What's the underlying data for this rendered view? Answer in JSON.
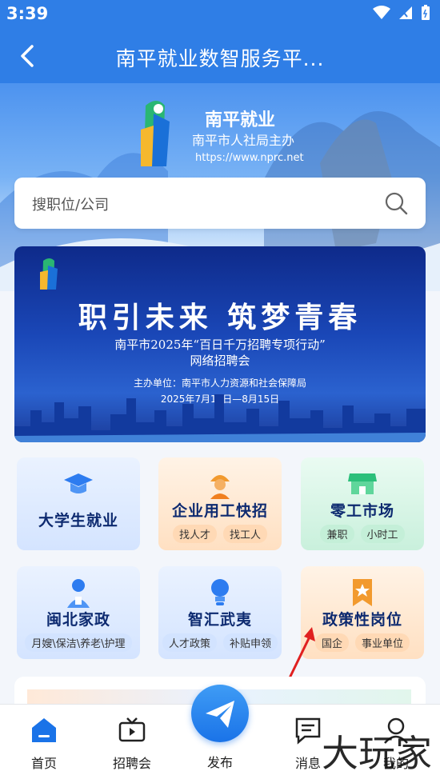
{
  "status_bar": {
    "time": "3:39"
  },
  "header": {
    "title": "南平就业数智服务平..."
  },
  "brand": {
    "name": "南平就业",
    "subtitle": "南平市人社局主办",
    "url": "https://www.nprc.net"
  },
  "search": {
    "placeholder": "搜职位/公司"
  },
  "banner": {
    "slogan": "职引未来  筑梦青春",
    "line1": "南平市2025年“百日千万招聘专项行动”",
    "line2": "网络招聘会",
    "organizer": "主办单位：南平市人力资源和社会保障局",
    "dates": "2025年7月15日—8月15日"
  },
  "services": [
    {
      "title": "大学生就业",
      "tags": []
    },
    {
      "title": "企业用工快招",
      "tags": [
        "找人才",
        "找工人"
      ]
    },
    {
      "title": "零工市场",
      "tags": [
        "兼职",
        "小时工"
      ]
    },
    {
      "title": "闽北家政",
      "tags": [
        "月嫂\\保洁\\养老\\护理"
      ]
    },
    {
      "title": "智汇武夷",
      "tags": [
        "人才政策",
        "补贴申领"
      ]
    },
    {
      "title": "政策性岗位",
      "tags": [
        "国企",
        "事业单位"
      ]
    }
  ],
  "nav": {
    "home": "首页",
    "job_fair": "招聘会",
    "publish": "发布",
    "messages": "消息",
    "mine": "我的"
  },
  "watermark": "大玩家",
  "colors": {
    "primary": "#2f7ee6",
    "nav_active": "#1a73e8"
  }
}
